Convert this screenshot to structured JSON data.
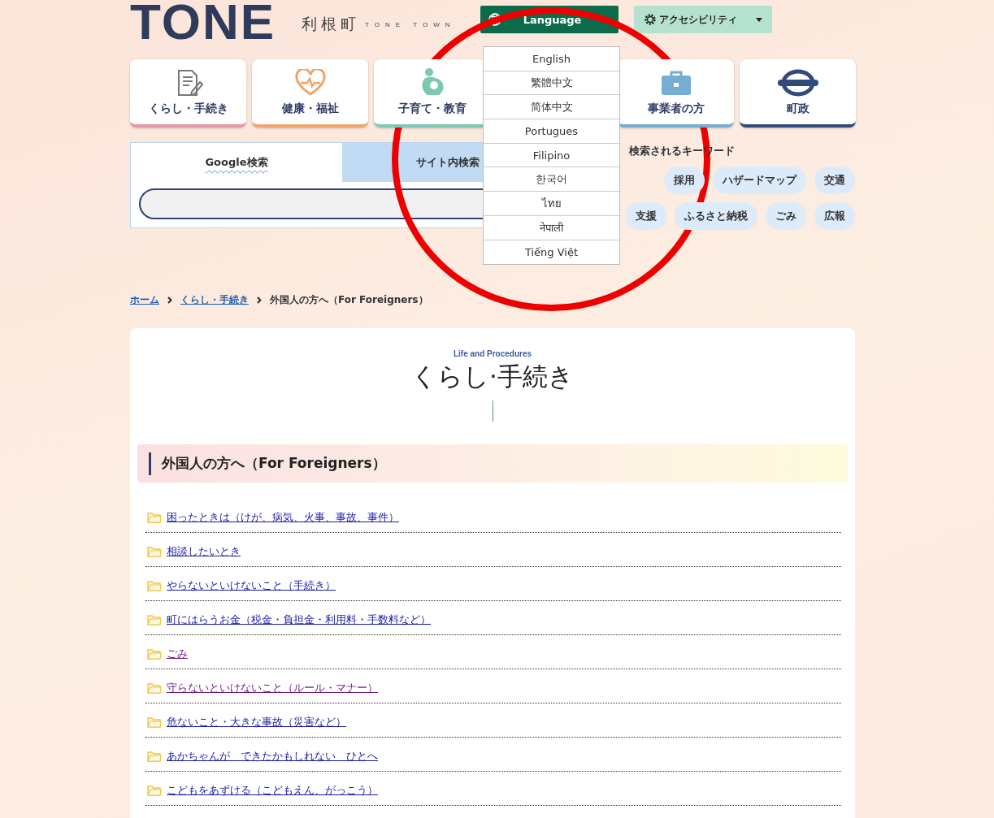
{
  "header": {
    "logo": "TONE",
    "town_name": "利根町",
    "town_name_en": "TONE TOWN",
    "language_button": {
      "label": "Language",
      "expanded": true
    },
    "accessibility_button": {
      "label": "アクセシビリティ"
    }
  },
  "language_menu": [
    "English",
    "繁體中文",
    "简体中文",
    "Portugues",
    "Filipino",
    "한국어",
    "ไทย",
    "नेपाली",
    "Tiếng Việt"
  ],
  "nav": [
    {
      "label": "くらし・手続き",
      "kind": "document",
      "color": "#e49aa6"
    },
    {
      "label": "健康・福祉",
      "kind": "heart",
      "color": "#eea56c"
    },
    {
      "label": "子育て・教育",
      "kind": "parent",
      "color": "#7cc8b2"
    },
    {
      "label": "事業者の方",
      "kind": "briefcase",
      "color": "#76aed3"
    },
    {
      "label": "町政",
      "kind": "ring",
      "color": "#2f4a7c"
    }
  ],
  "search": {
    "tabs": [
      {
        "label": "Google検索",
        "selected": true
      },
      {
        "label": "サイト内検索",
        "selected": false
      }
    ]
  },
  "keywords": {
    "title": "検索されるキーワード",
    "tags": [
      "採用",
      "ハザードマップ",
      "交通",
      "支援",
      "ふるさと納税",
      "ごみ",
      "広報"
    ]
  },
  "breadcrumb": [
    {
      "label": "ホーム",
      "kind": "link"
    },
    {
      "label": "くらし・手続き",
      "kind": "link"
    },
    {
      "label": "外国人の方へ（For Foreigners）",
      "kind": "current"
    }
  ],
  "page": {
    "subtitle": "Life and Procedures",
    "title": "くらし·手続き",
    "section_title": "外国人の方へ（For Foreigners）",
    "links": [
      {
        "label": "困ったときは（けが、病気、火事、事故、事件）",
        "visited": false
      },
      {
        "label": "相談したいとき",
        "visited": false
      },
      {
        "label": "やらないといけないこと（手続き）",
        "visited": false
      },
      {
        "label": "町にはらうお金（税金・負担金・利用料・手数料など）",
        "visited": false
      },
      {
        "label": "ごみ",
        "visited": true
      },
      {
        "label": "守らないといけないこと（ルール・マナー）",
        "visited": true
      },
      {
        "label": "危ないこと・大きな事故（災害など）",
        "visited": false
      },
      {
        "label": "あかちゃんが　できたかもしれない　ひとへ",
        "visited": false
      },
      {
        "label": "こどもをあずける（こどもえん、がっこう）",
        "visited": false
      }
    ]
  }
}
